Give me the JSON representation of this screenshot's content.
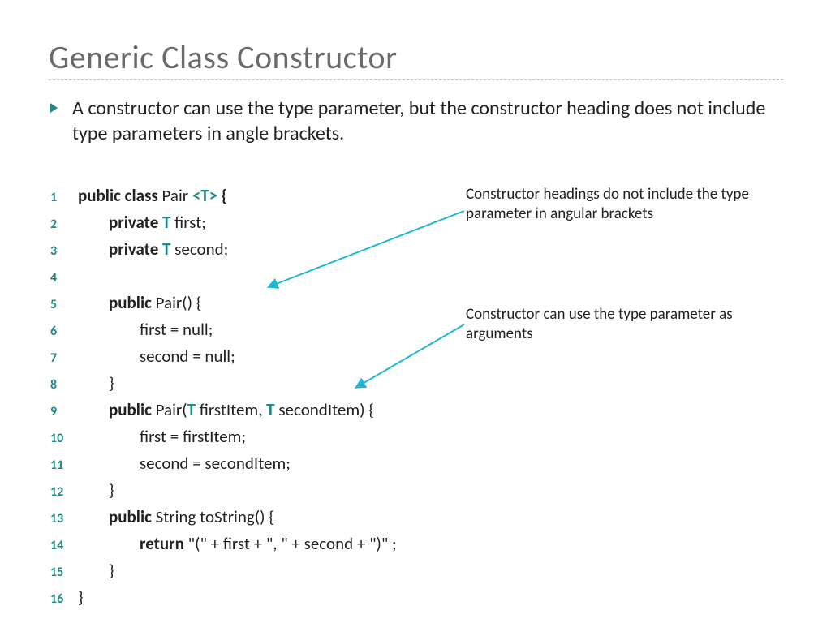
{
  "title": "Generic Class Constructor",
  "bullet": "A constructor can use the type parameter, but the constructor heading does not include type parameters in angle brackets.",
  "annotations": {
    "a1": "Constructor headings do not include the type parameter in angular brackets",
    "a2": "Constructor can use the type parameter as arguments"
  },
  "code": {
    "l1_pre": "public class ",
    "l1_name": "Pair ",
    "l1_t": "<T>",
    "l1_brace": " {",
    "l2_pre": "        private ",
    "l2_t": "T",
    "l2_rest": " first;",
    "l3_pre": "        private ",
    "l3_t": "T",
    "l3_rest": " second;",
    "l4": "",
    "l5_pre": "        public ",
    "l5_rest": "Pair() {",
    "l6": "                first = null;",
    "l7": "                second = null;",
    "l8": "        }",
    "l9_pre": "        public ",
    "l9_a": "Pair(",
    "l9_t1": "T",
    "l9_b": " firstItem, ",
    "l9_t2": "T",
    "l9_c": " secondItem) {",
    "l10": "                first = firstItem;",
    "l11": "                second = secondItem;",
    "l12": "        }",
    "l13_pre": "        public ",
    "l13_rest": "String toString() {",
    "l14_pre": "                return ",
    "l14_rest": "\"(\" + first + \", \" + second + \")\" ;",
    "l15": "        }",
    "l16": "}"
  },
  "linenos": {
    "n1": "1",
    "n2": "2",
    "n3": "3",
    "n4": "4",
    "n5": "5",
    "n6": "6",
    "n7": "7",
    "n8": "8",
    "n9": "9",
    "n10": "10",
    "n11": "11",
    "n12": "12",
    "n13": "13",
    "n14": "14",
    "n15": "15",
    "n16": "16"
  }
}
